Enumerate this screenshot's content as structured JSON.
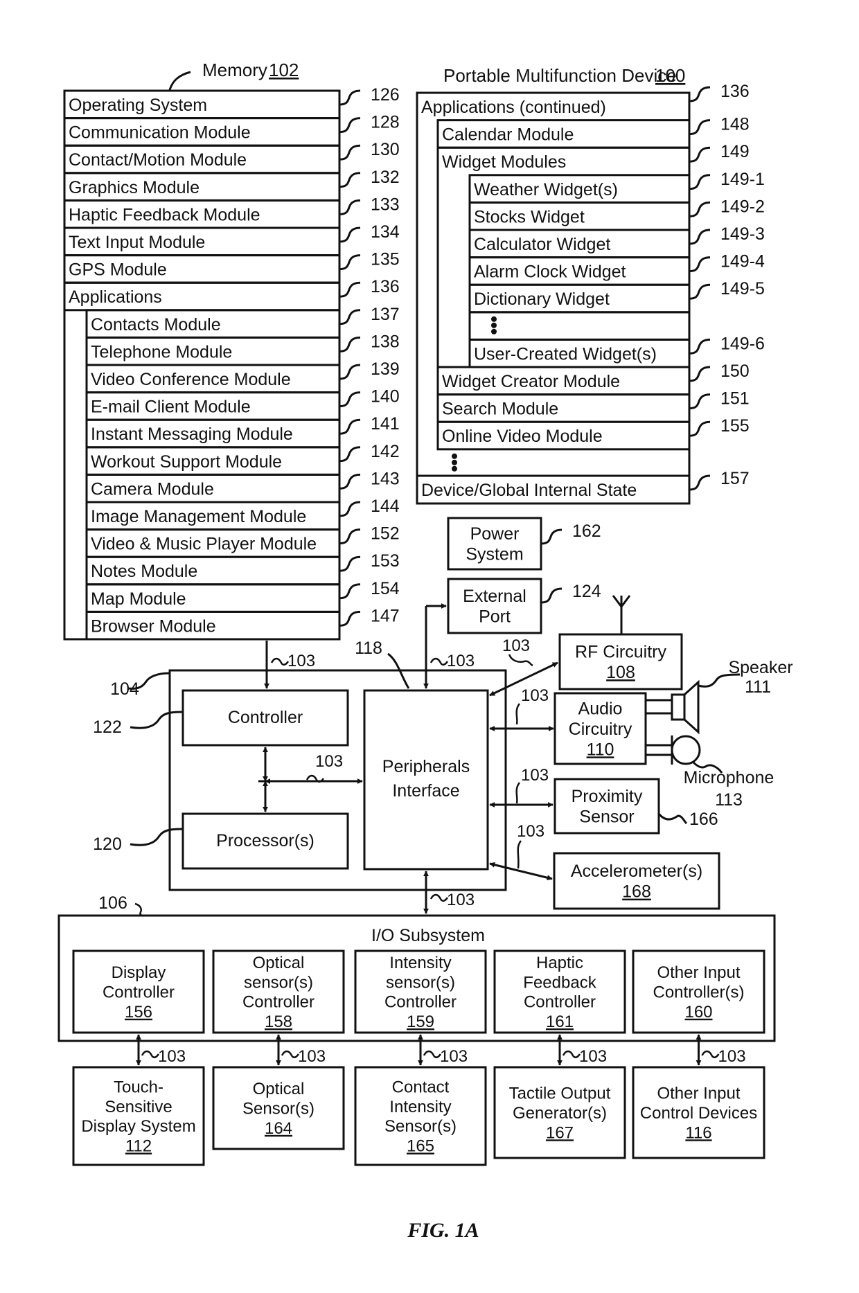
{
  "figure_caption": "FIG. 1A",
  "memory": {
    "title": "Memory",
    "ref": "102",
    "rows": [
      {
        "label": "Operating System",
        "ref": "126"
      },
      {
        "label": "Communication Module",
        "ref": "128"
      },
      {
        "label": "Contact/Motion Module",
        "ref": "130"
      },
      {
        "label": "Graphics Module",
        "ref": "132"
      },
      {
        "label": "Haptic Feedback Module",
        "ref": "133"
      },
      {
        "label": "Text Input Module",
        "ref": "134"
      },
      {
        "label": "GPS Module",
        "ref": "135"
      },
      {
        "label": "Applications",
        "ref": "136"
      }
    ],
    "app_rows": [
      {
        "label": "Contacts Module",
        "ref": "137"
      },
      {
        "label": "Telephone Module",
        "ref": "138"
      },
      {
        "label": "Video Conference Module",
        "ref": "139"
      },
      {
        "label": "E-mail Client Module",
        "ref": "140"
      },
      {
        "label": "Instant Messaging Module",
        "ref": "141"
      },
      {
        "label": "Workout Support Module",
        "ref": "142"
      },
      {
        "label": "Camera Module",
        "ref": "143"
      },
      {
        "label": "Image Management Module",
        "ref": "144"
      },
      {
        "label": "Video & Music Player Module",
        "ref": "152"
      },
      {
        "label": "Notes Module",
        "ref": "153"
      },
      {
        "label": "Map Module",
        "ref": "154"
      },
      {
        "label": "Browser Module",
        "ref": "147"
      }
    ]
  },
  "device": {
    "title": "Portable Multifunction Device",
    "ref": "100",
    "apps_continued": {
      "label": "Applications (continued)",
      "ref": "136"
    },
    "calendar": {
      "label": "Calendar Module",
      "ref": "148"
    },
    "widget_modules": {
      "label": "Widget Modules",
      "ref": "149"
    },
    "widgets": [
      {
        "label": "Weather Widget(s)",
        "ref": "149-1"
      },
      {
        "label": "Stocks Widget",
        "ref": "149-2"
      },
      {
        "label": "Calculator Widget",
        "ref": "149-3"
      },
      {
        "label": "Alarm Clock Widget",
        "ref": "149-4"
      },
      {
        "label": "Dictionary Widget",
        "ref": "149-5"
      },
      {
        "label": "User-Created Widget(s)",
        "ref": "149-6"
      }
    ],
    "lower_modules": [
      {
        "label": "Widget Creator Module",
        "ref": "150"
      },
      {
        "label": "Search Module",
        "ref": "151"
      },
      {
        "label": "Online Video Module",
        "ref": "155"
      }
    ],
    "global_state": {
      "label": "Device/Global Internal State",
      "ref": "157"
    }
  },
  "power_system": {
    "lines": [
      "Power",
      "System"
    ],
    "ref": "162"
  },
  "external_port": {
    "lines": [
      "External",
      "Port"
    ],
    "ref": "124"
  },
  "rf_circuitry": {
    "lines": [
      "RF Circuitry"
    ],
    "num": "108"
  },
  "audio_circuitry": {
    "lines": [
      "Audio",
      "Circuitry"
    ],
    "num": "110"
  },
  "speaker": {
    "label": "Speaker",
    "ref": "111"
  },
  "microphone": {
    "label": "Microphone",
    "ref": "113"
  },
  "proximity_sensor": {
    "lines": [
      "Proximity",
      "Sensor"
    ],
    "ref": "166"
  },
  "accelerometer": {
    "lines": [
      "Accelerometer(s)"
    ],
    "num": "168"
  },
  "core": {
    "ref": "104",
    "controller": {
      "label": "Controller",
      "ref": "122"
    },
    "processor": {
      "label": "Processor(s)",
      "ref": "120"
    },
    "peripherals": {
      "lines": [
        "Peripherals",
        "Interface"
      ],
      "ref": "118"
    }
  },
  "bus_ref": "103",
  "io_subsystem": {
    "title": "I/O Subsystem",
    "ref": "106",
    "controllers": [
      {
        "lines": [
          "Display",
          "Controller"
        ],
        "num": "156"
      },
      {
        "lines": [
          "Optical",
          "sensor(s)",
          "Controller"
        ],
        "num": "158"
      },
      {
        "lines": [
          "Intensity",
          "sensor(s)",
          "Controller"
        ],
        "num": "159"
      },
      {
        "lines": [
          "Haptic",
          "Feedback",
          "Controller"
        ],
        "num": "161"
      },
      {
        "lines": [
          "Other Input",
          "Controller(s)"
        ],
        "num": "160"
      }
    ]
  },
  "devices": [
    {
      "lines": [
        "Touch-",
        "Sensitive",
        "Display System"
      ],
      "num": "112"
    },
    {
      "lines": [
        "Optical",
        "Sensor(s)"
      ],
      "num": "164"
    },
    {
      "lines": [
        "Contact",
        "Intensity",
        "Sensor(s)"
      ],
      "num": "165"
    },
    {
      "lines": [
        "Tactile Output",
        "Generator(s)"
      ],
      "num": "167"
    },
    {
      "lines": [
        "Other Input",
        "Control Devices"
      ],
      "num": "116"
    }
  ]
}
